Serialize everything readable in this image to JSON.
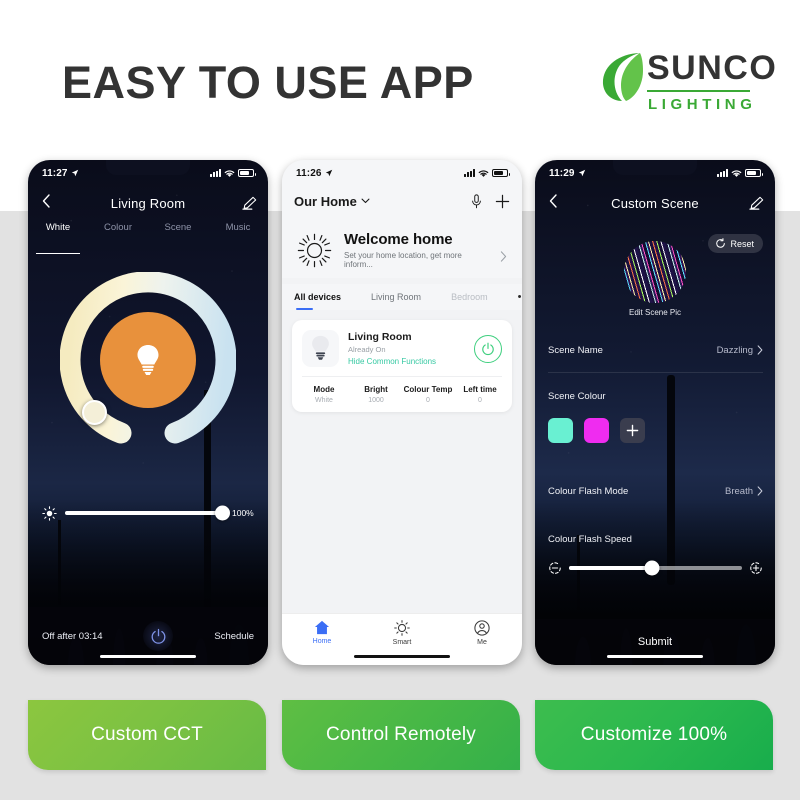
{
  "header": {
    "headline": "EASY TO USE APP",
    "logo": {
      "brand": "SUNCO",
      "tagline": "LIGHTING",
      "leaf_icon": "leaf-icon",
      "green": "#3aa935"
    }
  },
  "phone1": {
    "status": {
      "time": "11:27",
      "location_icon": "location-arrow-icon",
      "signal_icon": "cellular-bars-icon",
      "wifi_icon": "wifi-icon",
      "battery_icon": "battery-icon"
    },
    "nav": {
      "back_icon": "chevron-left-icon",
      "title": "Living Room",
      "edit_icon": "pencil-icon"
    },
    "tabs": [
      {
        "label": "White",
        "active": true
      },
      {
        "label": "Colour",
        "active": false
      },
      {
        "label": "Scene",
        "active": false
      },
      {
        "label": "Music",
        "active": false
      }
    ],
    "dial": {
      "name": "cct-dial",
      "center_icon": "bulb-icon",
      "warm_color": "#f2e9c2",
      "cool_color": "#cfe4ef",
      "center_color": "#e8913c"
    },
    "brightness": {
      "icon": "brightness-icon",
      "value_label": "100%",
      "percent": 100
    },
    "footer": {
      "timer": "Off after 03:14",
      "power_icon": "power-icon",
      "schedule": "Schedule"
    }
  },
  "phone2": {
    "status": {
      "time": "11:26",
      "location_icon": "location-arrow-icon",
      "signal_icon": "cellular-bars-icon",
      "wifi_icon": "wifi-icon",
      "battery_icon": "battery-icon"
    },
    "home_selector": {
      "label": "Our Home",
      "chevron_icon": "chevron-down-icon"
    },
    "actions": {
      "mic_icon": "microphone-icon",
      "add_icon": "plus-icon"
    },
    "welcome": {
      "icon": "sun-icon",
      "title": "Welcome home",
      "subtitle": "Set your home location, get more inform...",
      "chevron_icon": "chevron-right-icon"
    },
    "tabs": [
      {
        "label": "All devices",
        "active": true,
        "faded": false
      },
      {
        "label": "Living Room",
        "active": false,
        "faded": false
      },
      {
        "label": "Bedroom",
        "active": false,
        "faded": true
      }
    ],
    "tabs_overflow_icon": "ellipsis-icon",
    "device": {
      "icon": "bulb-icon",
      "name": "Living Room",
      "state": "Already On",
      "link": "Hide Common Functions",
      "power_icon": "power-icon",
      "stats": [
        {
          "key": "Mode",
          "value": "White"
        },
        {
          "key": "Bright",
          "value": "1000"
        },
        {
          "key": "Colour Temp",
          "value": "0"
        },
        {
          "key": "Left time",
          "value": "0"
        }
      ]
    },
    "bottom_nav": [
      {
        "label": "Home",
        "icon": "home-icon",
        "active": true
      },
      {
        "label": "Smart",
        "icon": "sun-icon",
        "active": false
      },
      {
        "label": "Me",
        "icon": "person-icon",
        "active": false
      }
    ]
  },
  "phone3": {
    "status": {
      "time": "11:29",
      "location_icon": "location-arrow-icon",
      "signal_icon": "cellular-bars-icon",
      "wifi_icon": "wifi-icon",
      "battery_icon": "battery-icon"
    },
    "nav": {
      "back_icon": "chevron-left-icon",
      "title": "Custom Scene",
      "edit_icon": "pencil-icon"
    },
    "reset": {
      "label": "Reset",
      "icon": "refresh-icon"
    },
    "scene_pic_label": "Edit Scene Pic",
    "scene_name": {
      "key": "Scene Name",
      "value": "Dazzling",
      "chevron_icon": "chevron-right-icon"
    },
    "scene_colour": {
      "key": "Scene Colour",
      "swatches": [
        "#69f0d2",
        "#ef2cf0"
      ],
      "add_icon": "plus-icon"
    },
    "flash_mode": {
      "key": "Colour Flash Mode",
      "value": "Breath",
      "chevron_icon": "chevron-right-icon"
    },
    "flash_speed": {
      "key": "Colour Flash Speed",
      "slow_icon": "slow-speed-icon",
      "fast_icon": "fast-speed-icon",
      "percent": 48
    },
    "submit": "Submit"
  },
  "captions": [
    {
      "label": "Custom CCT"
    },
    {
      "label": "Control Remotely"
    },
    {
      "label": "Customize 100%"
    }
  ]
}
